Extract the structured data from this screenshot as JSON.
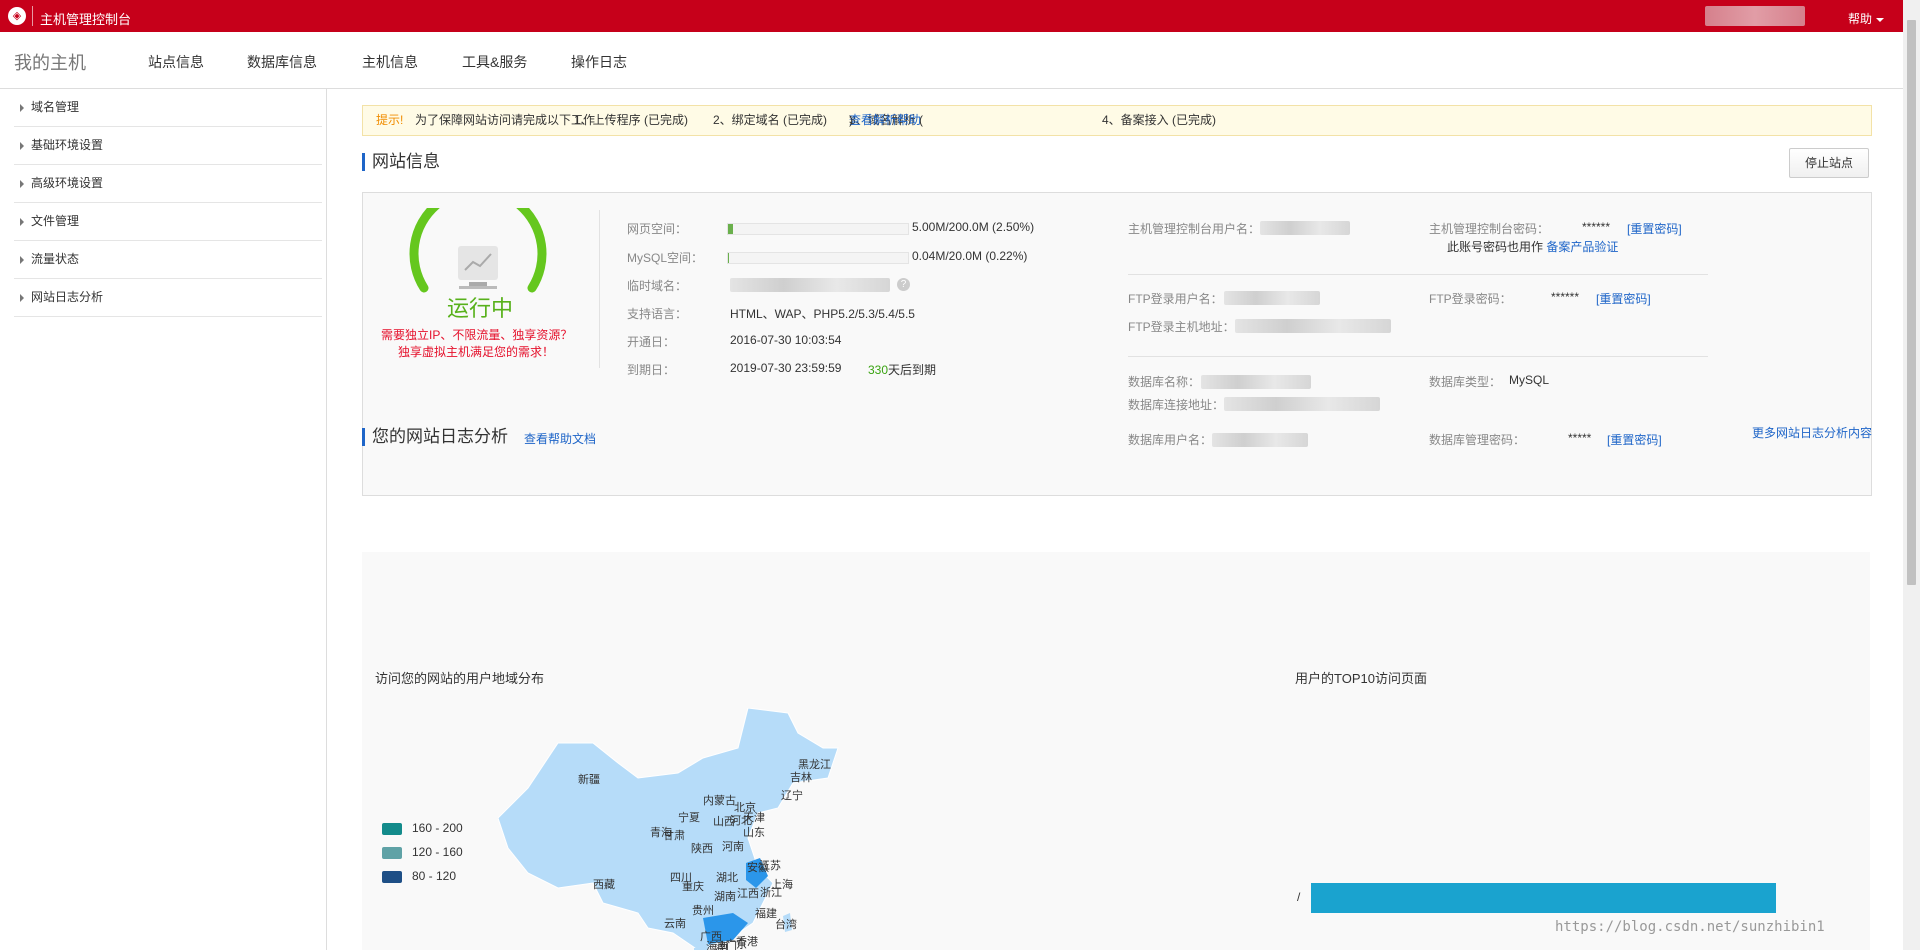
{
  "topbar": {
    "title": "主机管理控制台",
    "help": "帮助"
  },
  "nav": {
    "brand": "我的主机",
    "items": [
      "站点信息",
      "数据库信息",
      "主机信息",
      "工具&服务",
      "操作日志"
    ]
  },
  "sidebar": {
    "items": [
      "域名管理",
      "基础环境设置",
      "高级环境设置",
      "文件管理",
      "流量状态",
      "网站日志分析"
    ]
  },
  "tip": {
    "label": "提示!",
    "text": "为了保障网站访问请完成以下工作",
    "step1": "1、上传程序 (已完成)",
    "step2": "2、绑定域名 (已完成)",
    "step3_pre": "3、域名解析 (",
    "step3_link": "查看解析帮助",
    "step3_post": ")",
    "step4": "4、备案接入 (已完成)"
  },
  "site_info": {
    "title": "网站信息",
    "stop_button": "停止站点",
    "status": "运行中",
    "promo_line1": "需要独立IP、不限流量、独享资源？",
    "promo_line2": "独享虚拟主机满足您的需求！",
    "web_space_label": "网页空间：",
    "web_space_value": "5.00M/200.0M (2.50%)",
    "web_space_fraction": 0.025,
    "mysql_space_label": "MySQL空间：",
    "mysql_space_value": "0.04M/20.0M (0.22%)",
    "mysql_space_fraction": 0.0022,
    "temp_domain_label": "临时域名：",
    "lang_label": "支持语言：",
    "lang_value": "HTML、WAP、PHP5.2/5.3/5.4/5.5",
    "open_date_label": "开通日：",
    "open_date_value": "2016-07-30 10:03:54",
    "expire_label": "到期日：",
    "expire_value": "2019-07-30 23:59:59",
    "days_left": "330",
    "days_left_suffix": "天后到期",
    "console_user_label": "主机管理控制台用户名：",
    "console_pwd_label": "主机管理控制台密码：",
    "console_pwd_value": "******",
    "reset_pwd": "[重置密码]",
    "account_note": "此账号密码也用作",
    "record_verify": "备案产品验证",
    "ftp_user_label": "FTP登录用户名：",
    "ftp_pwd_label": "FTP登录密码：",
    "ftp_pwd_value": "******",
    "ftp_host_label": "FTP登录主机地址：",
    "db_name_label": "数据库名称：",
    "db_type_label": "数据库类型：",
    "db_type_value": "MySQL",
    "db_host_label": "数据库连接地址：",
    "db_user_label": "数据库用户名：",
    "db_pwd_label": "数据库管理密码：",
    "db_pwd_value": "*****"
  },
  "log_analysis": {
    "title": "您的网站日志分析",
    "help_link": "查看帮助文档",
    "more_link": "更多网站日志分析内容",
    "map_title": "访问您的网站的用户地域分布",
    "top10_title": "用户的TOP10访问页面",
    "top10_bar_label": "/",
    "legend": [
      {
        "label": "160 - 200",
        "color": "#138b8b"
      },
      {
        "label": "120 - 160",
        "color": "#5fa2a6"
      },
      {
        "label": "80 - 120",
        "color": "#1e4f86"
      }
    ],
    "provinces": [
      "新疆",
      "西藏",
      "青海",
      "甘肃",
      "宁夏",
      "内蒙古",
      "黑龙江",
      "吉林",
      "辽宁",
      "北京",
      "天津",
      "河北",
      "山西",
      "山东",
      "陕西",
      "河南",
      "四川",
      "重庆",
      "湖北",
      "安徽",
      "江苏",
      "上海",
      "浙江",
      "湖南",
      "江西",
      "贵州",
      "云南",
      "福建",
      "台湾",
      "广西",
      "广东",
      "香港",
      "澳门",
      "海南"
    ]
  },
  "watermark": "https://blog.csdn.net/sunzhibin1"
}
